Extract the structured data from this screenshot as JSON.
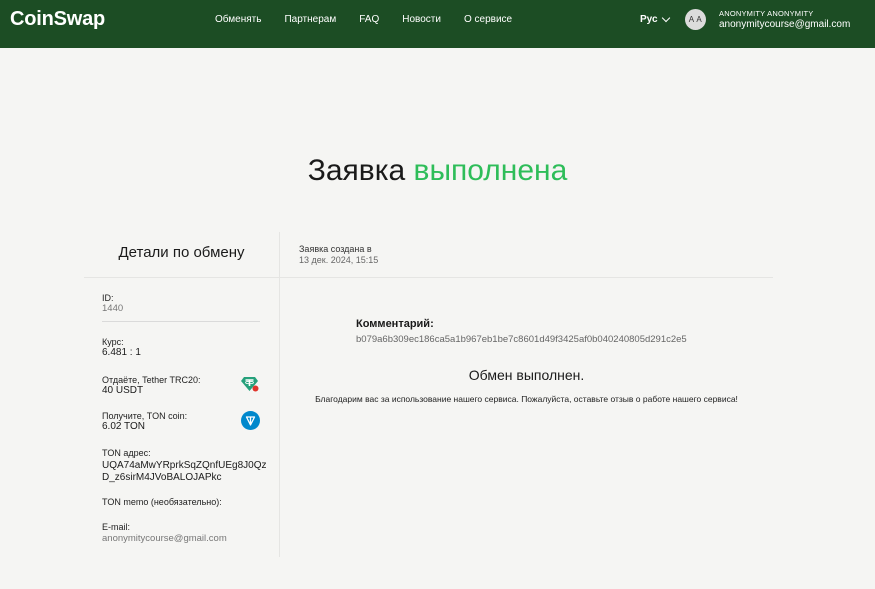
{
  "header": {
    "logo": "CoinSwap",
    "nav": [
      "Обменять",
      "Партнерам",
      "FAQ",
      "Новости",
      "О сервисе"
    ],
    "language": "Рус",
    "avatar_initials": "A A",
    "user_name": "ANONYMITY ANONYMITY",
    "user_email": "anonymitycourse@gmail.com"
  },
  "page": {
    "title_main": "Заявка",
    "title_status": "выполнена"
  },
  "details": {
    "heading": "Детали по обмену",
    "id_label": "ID:",
    "id_value": "1440",
    "rate_label": "Курс:",
    "rate_value": "6.481 : 1",
    "give_label": "Отдаёте, Tether TRC20:",
    "give_value": "40 USDT",
    "get_label": "Получите, TON coin:",
    "get_value": "6.02 TON",
    "address_label": "TON адрес:",
    "address_value": "UQA74aMwYRprkSqZQnfUEg8J0QzD_z6sirM4JVoBALOJAPkc",
    "memo_label": "TON memo (необязательно):",
    "email_label": "E-mail:",
    "email_value": "anonymitycourse@gmail.com"
  },
  "order": {
    "created_label": "Заявка создана в",
    "created_value": "13 дек. 2024, 15:15",
    "comment_label": "Комментарий:",
    "comment_value": "b079a6b309ec186ca5a1b967eb1be7c8601d49f3425af0b040240805d291c2e5",
    "done_message": "Обмен выполнен.",
    "thanks_message": "Благодарим вас за использование нашего сервиса. Пожалуйста, оставьте отзыв о работе нашего сервиса!"
  },
  "colors": {
    "header_bg": "#1c4d24",
    "accent_green": "#2ebd59",
    "usdt_icon": "#26a17b",
    "ton_icon": "#0088cc"
  },
  "icons": {
    "usdt": "tether-trc20-icon",
    "ton": "ton-coin-icon",
    "language_dropdown": "chevron-down-icon"
  }
}
